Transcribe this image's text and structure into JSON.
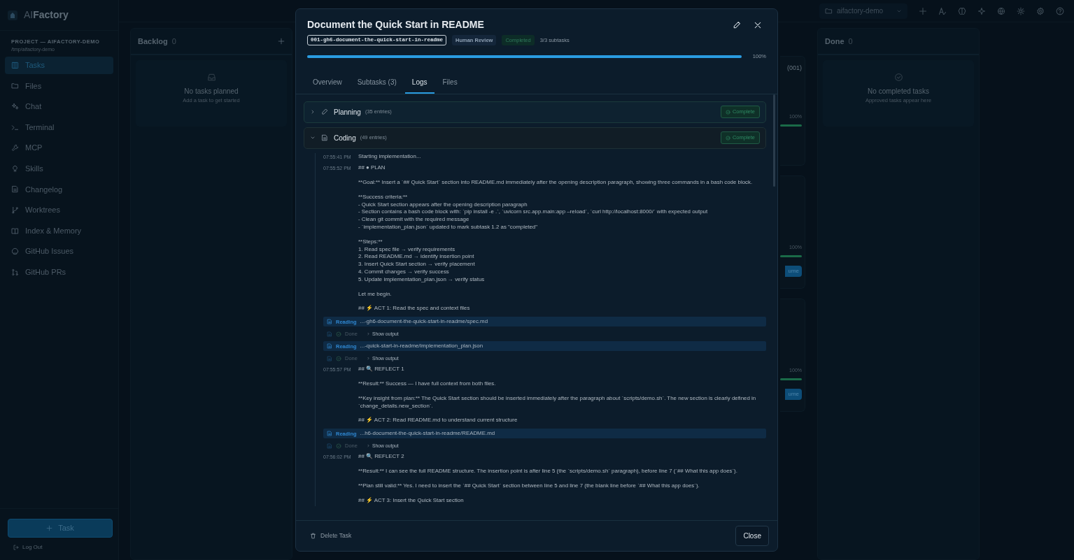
{
  "app": {
    "name": "AI**Factory**"
  },
  "sidebar": {
    "project_label": "PROJECT — AIFACTORY-DEMO",
    "project_path": "/tmp/aifactory-demo",
    "items": [
      {
        "label": "Tasks",
        "selected": true
      },
      {
        "label": "Files",
        "selected": false
      },
      {
        "label": "Chat",
        "selected": false
      },
      {
        "label": "Terminal",
        "selected": false
      },
      {
        "label": "MCP",
        "selected": false
      },
      {
        "label": "Skills",
        "selected": false
      },
      {
        "label": "Changelog",
        "selected": false
      },
      {
        "label": "Worktrees",
        "selected": false
      },
      {
        "label": "Index & Memory",
        "selected": false
      },
      {
        "label": "GitHub Issues",
        "selected": false
      },
      {
        "label": "GitHub PRs",
        "selected": false
      }
    ],
    "new_task_button": "Task",
    "logout": "Log Out"
  },
  "topbar": {
    "project_select": "aifactory-demo"
  },
  "columns": [
    {
      "title": "Backlog",
      "count": "0",
      "empty_title": "No tasks planned",
      "empty_hint": "Add a task to get started",
      "can_add": true
    },
    {
      "title": "Done",
      "count": "0",
      "empty_title": "No completed tasks",
      "empty_hint": "Approved tasks appear here",
      "can_add": false
    }
  ],
  "partly_hidden_column": {
    "cards": [
      {
        "id": "(001)",
        "progress": "100%",
        "level": 1
      },
      {
        "progress": "100%",
        "level": 1,
        "button": "ume"
      },
      {
        "progress": "100%",
        "level": 1,
        "button": "ume"
      }
    ]
  },
  "task_dialog": {
    "title": "Document the Quick Start in README",
    "spec_id": "001-gh6-document-the-quick-start-in-readme",
    "review_badge": "Human Review",
    "status_badge": "Completed",
    "subtasks": "3/3 subtasks",
    "level": 1,
    "progress": "100%",
    "tabs": [
      {
        "label": "Overview",
        "selected": false
      },
      {
        "label": "Subtasks (3)",
        "selected": false
      },
      {
        "label": "Logs",
        "selected": true
      },
      {
        "label": "Files",
        "selected": false
      }
    ],
    "phases": [
      {
        "title": "Planning",
        "count": "(35 entries)",
        "status": "Complete",
        "expanded": false
      },
      {
        "title": "Coding",
        "count": "(49 entries)",
        "status": "Complete",
        "expanded": true,
        "entries": [
          {
            "kind": "message",
            "time": "07:55:41 PM",
            "paragraphs": [
              "Starting implementation..."
            ]
          },
          {
            "kind": "message",
            "time": "07:55:52 PM",
            "paragraphs": [
              "## ● PLAN",
              "**Goal:** Insert a `## Quick Start` section into README.md immediately after the opening description paragraph, showing three commands in a bash code block.",
              "**Success criteria:**\n- Quick Start section appears after the opening description paragraph\n- Section contains a bash code block with: `pip install -e .`, `uvicorn src.app.main:app –reload`, `curl http://localhost:8000/` with expected output\n- Clean git commit with the required message\n- `implementation_plan.json` updated to mark subtask 1.2 as \"completed\"",
              "**Steps:**\n1. Read spec file → verify requirements\n2. Read README.md → identify insertion point\n3. Insert Quick Start section → verify placement\n4. Commit changes → verify success\n5. Update implementation_plan.json → verify status",
              "Let me begin.",
              "## ⚡ ACT 1: Read the spec and context files"
            ]
          },
          {
            "kind": "tool",
            "action": "Reading",
            "path": "...-gh6-document-the-quick-start-in-readme/spec.md"
          },
          {
            "kind": "result",
            "status": "Done",
            "toggle": "Show output"
          },
          {
            "kind": "tool",
            "action": "Reading",
            "path": "...-quick-start-in-readme/implementation_plan.json"
          },
          {
            "kind": "result",
            "status": "Done",
            "toggle": "Show output"
          },
          {
            "kind": "message",
            "time": "07:55:57 PM",
            "paragraphs": [
              "## 🔍 REFLECT 1",
              "**Result:** Success — I have full context from both files.",
              "**Key insight from plan:** The Quick Start section should be inserted immediately after the paragraph about `scripts/demo.sh`. The new section is clearly defined in `change_details.new_section`.",
              "## ⚡ ACT 2: Read README.md to understand current structure"
            ]
          },
          {
            "kind": "tool",
            "action": "Reading",
            "path": "...h6-document-the-quick-start-in-readme/README.md"
          },
          {
            "kind": "result",
            "status": "Done",
            "toggle": "Show output"
          },
          {
            "kind": "message",
            "time": "07:56:02 PM",
            "paragraphs": [
              "## 🔍 REFLECT 2",
              "**Result:** I can see the full README structure. The insertion point is after line 5 (the `scripts/demo.sh` paragraph), before line 7 (`## What this app does`).",
              "**Plan still valid:** Yes. I need to insert the `## Quick Start` section between line 5 and line 7 (the blank line before `## What this app does`).",
              "## ⚡ ACT 3: Insert the Quick Start section"
            ]
          }
        ]
      }
    ],
    "delete_button": "Delete Task",
    "close_button": "Close"
  }
}
